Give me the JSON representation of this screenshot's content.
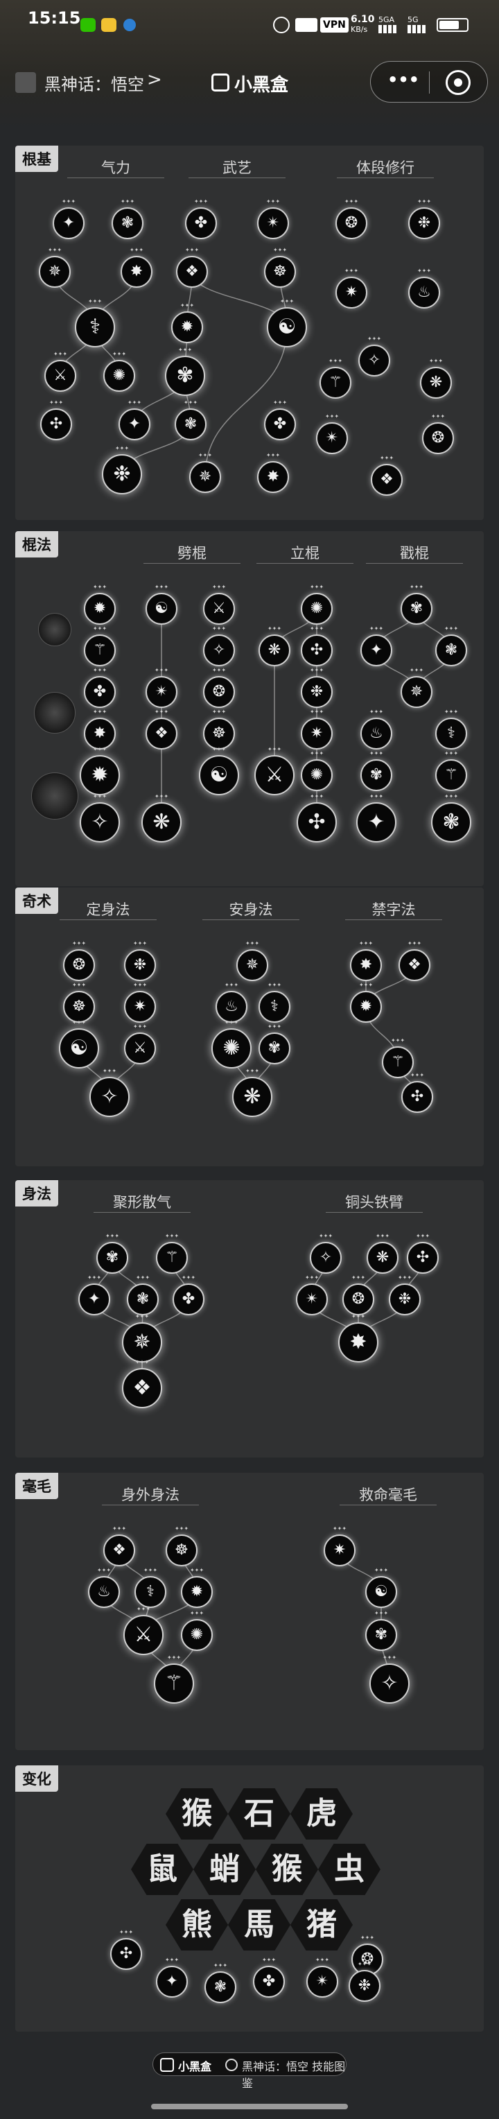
{
  "status": {
    "time": "15:15",
    "speed_value": "6.10",
    "speed_unit": "KB/s",
    "vpn": "VPN",
    "net1": "5GA",
    "net2": "5G"
  },
  "nav": {
    "title": "黑神话：悟空",
    "chevron": ">",
    "brand": "小黑盒",
    "more": "•••"
  },
  "sections": [
    {
      "title": "根基",
      "groups": [
        "气力",
        "武艺",
        "体段修行"
      ]
    },
    {
      "title": "棍法",
      "groups": [
        "劈棍",
        "立棍",
        "戳棍"
      ]
    },
    {
      "title": "奇术",
      "groups": [
        "定身法",
        "安身法",
        "禁字法"
      ]
    },
    {
      "title": "身法",
      "groups": [
        "聚形散气",
        "铜头铁臂"
      ]
    },
    {
      "title": "毫毛",
      "groups": [
        "身外身法",
        "救命毫毛"
      ]
    },
    {
      "title": "变化",
      "groups": []
    }
  ],
  "transform_chars": [
    "猴",
    "石",
    "虎",
    "鼠",
    "蛸",
    "猴",
    "虫",
    "熊",
    "馬",
    "猪"
  ],
  "footer": {
    "brand": "小黑盒",
    "search": "黑神话：悟空 技能图鉴"
  }
}
